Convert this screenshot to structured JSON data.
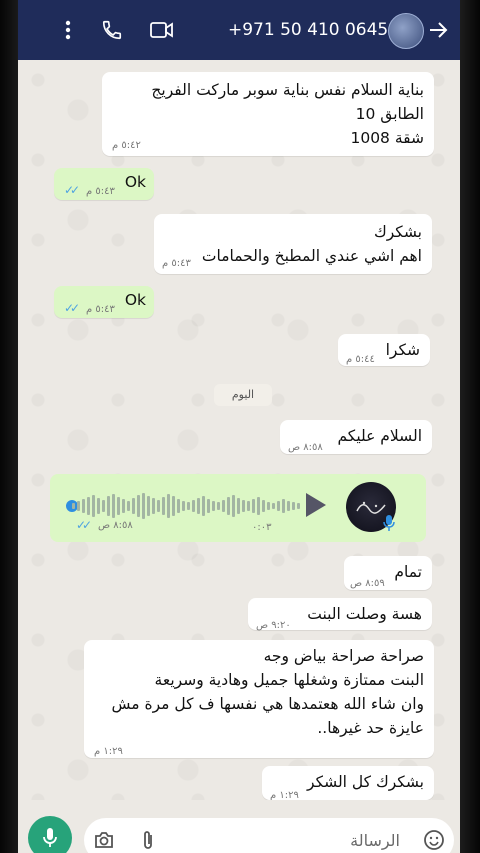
{
  "header": {
    "title": "+971 50 410 0645"
  },
  "messages": [
    {
      "text": "بناية السلام نفس بناية سوبر ماركت الفريج\nالطابق 10\nشقة 1008",
      "time": "٥:٤٢ م"
    },
    {
      "text": "Ok",
      "time": "٥:٤٣ م"
    },
    {
      "text": "بشكرك\nاهم اشي عندي المطبخ والحمامات",
      "time": "٥:٤٣ م"
    },
    {
      "text": "Ok",
      "time": "٥:٤٣ م"
    },
    {
      "text": "شكرا",
      "time": "٥:٤٤ م"
    },
    {
      "text": "السلام عليكم",
      "time": "٨:٥٨ ص"
    },
    {
      "text": "تمام",
      "time": "٨:٥٩ ص"
    },
    {
      "text": "هسة وصلت البنت",
      "time": "٩:٢٠ ص"
    },
    {
      "text": "صراحة صراحة بياض وجه\nالبنت ممتازة وشغلها جميل وهادية وسريعة\nوان شاء الله هعتمدها هي نفسها ف كل مرة مش\nعايزة حد غيرها..",
      "time": "١:٢٩ م"
    },
    {
      "text": "بشكرك كل الشكر",
      "time": "١:٢٩ م"
    }
  ],
  "date_chip": "اليوم",
  "voice": {
    "duration": "٠:٠٣",
    "time": "٨:٥٨ ص",
    "progress": 0
  },
  "input": {
    "placeholder": "الرسالة"
  },
  "colors": {
    "header": "#1f2c5a",
    "incoming": "#ffffff",
    "outgoing": "#dcf7c5",
    "read_ticks": "#4fa3e0",
    "mic_button": "#27a37a"
  },
  "icons": [
    "more-vert-icon",
    "call-icon",
    "video-call-icon",
    "back-arrow-icon",
    "play-icon",
    "mic-icon",
    "camera-icon",
    "attach-icon",
    "emoji-icon"
  ]
}
